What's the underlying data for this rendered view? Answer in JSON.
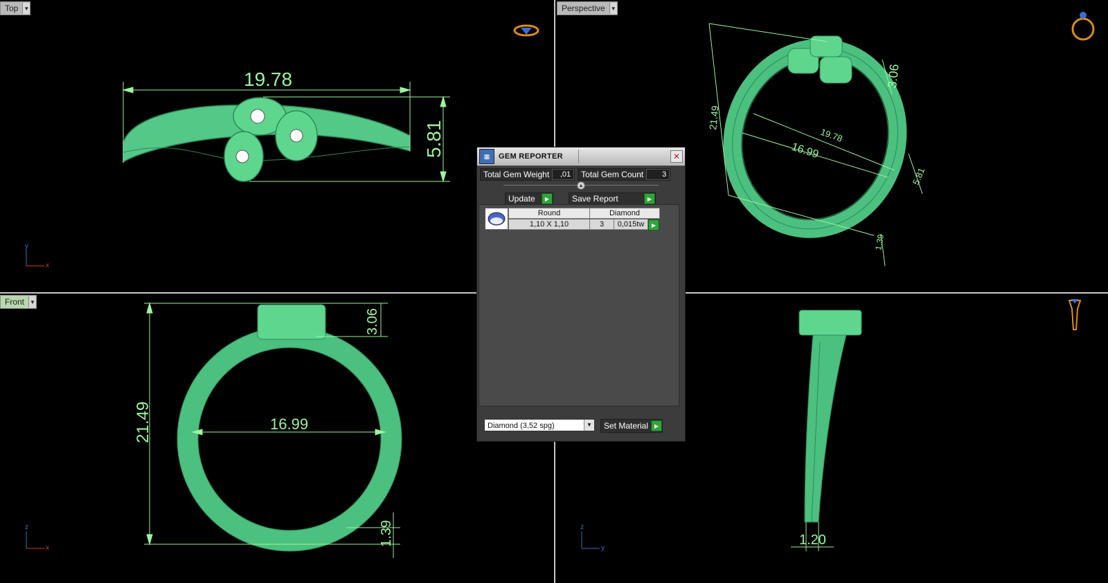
{
  "viewports": {
    "top": {
      "label": "Top",
      "dims": {
        "width": "19.78",
        "height": "5.81"
      }
    },
    "perspective": {
      "label": "Perspective",
      "dims": {
        "height": "21.49",
        "outer": "19.78",
        "inner": "16.99",
        "top": "3.06",
        "side": "5.81",
        "bottom": "1.39"
      }
    },
    "front": {
      "label": "Front",
      "dims": {
        "height": "21.49",
        "inner": "16.99",
        "top": "3.06",
        "bottom": "1.39"
      }
    },
    "right": {
      "dims": {
        "thickness": "1.20"
      }
    }
  },
  "axes": {
    "top": {
      "v": "y",
      "h": "x"
    },
    "front": {
      "v": "z",
      "h": "x"
    },
    "right": {
      "v": "z",
      "h": "y"
    }
  },
  "gem_reporter": {
    "title": "GEM REPORTER",
    "total_weight_label": "Total Gem Weight",
    "total_weight_value": ",01",
    "total_count_label": "Total Gem Count",
    "total_count_value": "3",
    "update_label": "Update",
    "save_report_label": "Save Report",
    "rows": [
      {
        "shape": "Round",
        "material": "Diamond",
        "size": "1,10 X 1,10",
        "count": "3",
        "weight": "0,015tw"
      }
    ],
    "material_select": "Diamond    (3,52 spg)",
    "set_material_label": "Set Material"
  },
  "colors": {
    "model": "#5fd68e",
    "model_dark": "#2f8f5c",
    "dimension": "#9df59d"
  }
}
